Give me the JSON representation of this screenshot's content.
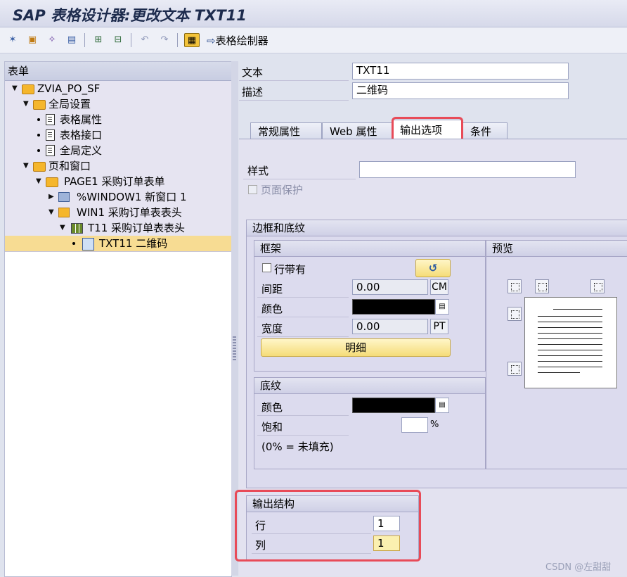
{
  "window": {
    "title": "SAP 表格设计器:更改文本 TXT11"
  },
  "toolbar": {
    "icons": [
      "glasses-icon",
      "hierarchy-icon",
      "wand-icon",
      "printer-icon",
      "expand-icon",
      "collapse-icon",
      "undo-icon",
      "redo-icon",
      "form-painter-icon"
    ],
    "form_painter_label": "表格绘制器"
  },
  "tree": {
    "header": "表单",
    "nodes": [
      {
        "label": "ZVIA_PO_SF",
        "icon": "folder-icon",
        "level": 0
      },
      {
        "label": "全局设置",
        "icon": "folder-icon",
        "level": 1
      },
      {
        "label": "表格属性",
        "icon": "document-icon",
        "level": 2
      },
      {
        "label": "表格接口",
        "icon": "document-icon",
        "level": 2
      },
      {
        "label": "全局定义",
        "icon": "document-icon",
        "level": 2
      },
      {
        "label": "页和窗口",
        "icon": "folder-icon",
        "level": 1
      },
      {
        "label": "PAGE1 采购订单表单",
        "icon": "folder-icon",
        "level": 2
      },
      {
        "label": "%WINDOW1 新窗口 1",
        "icon": "window-icon",
        "level": 3
      },
      {
        "label": "WIN1 采购订单表表头",
        "icon": "window-icon",
        "level": 3
      },
      {
        "label": "T11 采购订单表表头",
        "icon": "table-icon",
        "level": 4
      },
      {
        "label": "TXT11 二维码",
        "icon": "text-node-icon",
        "level": 5
      }
    ]
  },
  "header_fields": {
    "text_label": "文本",
    "text_value": "TXT11",
    "desc_label": "描述",
    "desc_value": "二维码"
  },
  "tabs": [
    "常规属性",
    "Web 属性",
    "输出选项",
    "条件"
  ],
  "active_tab": "输出选项",
  "output_options": {
    "style_label": "样式",
    "style_value": "",
    "page_protect_label": "页面保护",
    "border_group_title": "边框和底纹",
    "frame": {
      "title": "框架",
      "with_lines_label": "行带有",
      "spacing_label": "间距",
      "spacing_value": "0.00",
      "spacing_unit": "CM",
      "color_label": "颜色",
      "width_label": "宽度",
      "width_value": "0.00",
      "width_unit": "PT",
      "details_button": "明细"
    },
    "preview_title": "预览",
    "shading": {
      "title": "底纹",
      "color_label": "颜色",
      "saturation_label": "饱和",
      "saturation_value": "",
      "percent": "%",
      "note": "(0% = 未填充)"
    },
    "output_structure": {
      "title": "输出结构",
      "row_label": "行",
      "row_value": "1",
      "col_label": "列",
      "col_value": "1"
    }
  },
  "watermark": "CSDN @左甜甜",
  "colors": {
    "highlight": "#e84b58",
    "selection": "#f7dc93",
    "accent_button": "#f5dc78"
  }
}
